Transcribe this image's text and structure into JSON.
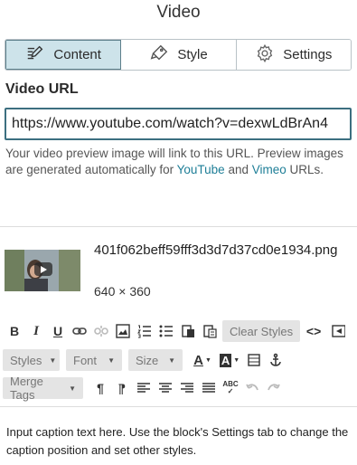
{
  "panel_title": "Video",
  "tabs": [
    {
      "label": "Content",
      "icon": "content-icon",
      "active": true
    },
    {
      "label": "Style",
      "icon": "style-icon"
    },
    {
      "label": "Settings",
      "icon": "settings-gear-icon"
    }
  ],
  "video_url": {
    "label": "Video URL",
    "value": "https://www.youtube.com/watch?v=dexwLdBrAn4",
    "help_prefix": "Your video preview image will link to this URL. Preview images are generated automatically for ",
    "help_youtube": "YouTube",
    "help_and": " and ",
    "help_vimeo": "Vimeo",
    "help_suffix": " URLs."
  },
  "file": {
    "name": "401f062beff59fff3d3d7d37cd0e1934.png",
    "dimensions": "640 × 360"
  },
  "toolbar": {
    "clear_styles": "Clear Styles",
    "styles_label": "Styles",
    "font_label": "Font",
    "size_label": "Size",
    "merge_tags_label": "Merge Tags"
  },
  "caption": "Input caption text here. Use the block's Settings tab to change the caption position and set other styles.",
  "colors": {
    "accent": "#3c6f80",
    "active_tab_bg": "#cde3ea",
    "link": "#1e7e97"
  }
}
